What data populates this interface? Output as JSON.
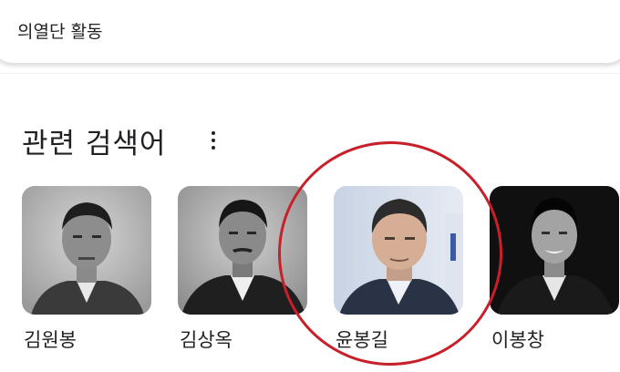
{
  "search": {
    "query": "의열단 활동"
  },
  "related": {
    "title": "관련 검색어",
    "more_icon": "more-vert-icon",
    "items": [
      {
        "name": "김원봉",
        "photo": "portrait-photo"
      },
      {
        "name": "김상옥",
        "photo": "portrait-photo"
      },
      {
        "name": "윤봉길",
        "photo": "portrait-photo"
      },
      {
        "name": "이봉창",
        "photo": "portrait-photo"
      }
    ]
  },
  "colors": {
    "highlight": "#c8202a",
    "text": "#202124",
    "border": "#dfe1e5"
  }
}
